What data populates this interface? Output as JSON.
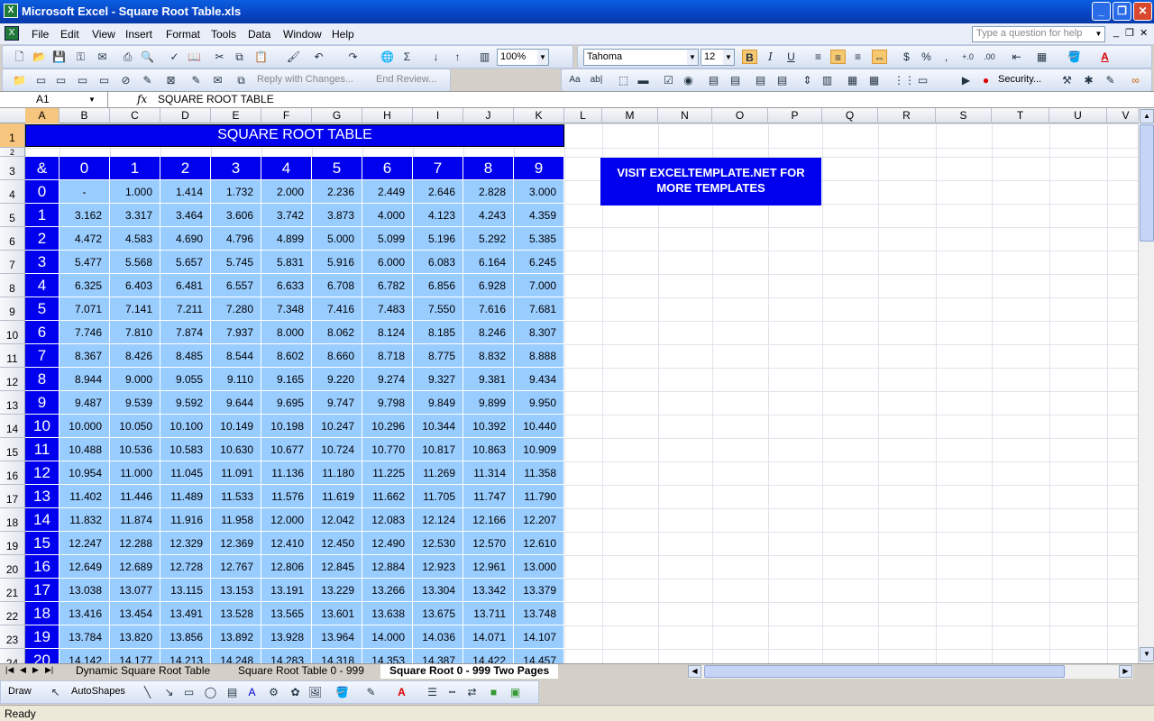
{
  "window": {
    "title": "Microsoft Excel - Square Root Table.xls",
    "app_icon": "excel-icon",
    "controls": [
      "_",
      "❐",
      "✕"
    ]
  },
  "menu": {
    "items": [
      "File",
      "Edit",
      "View",
      "Insert",
      "Format",
      "Tools",
      "Data",
      "Window",
      "Help"
    ],
    "help_placeholder": "Type a question for help",
    "doc_controls": [
      "_",
      "❐",
      "✕"
    ]
  },
  "toolbar": {
    "zoom": "100%",
    "font_name": "Tahoma",
    "font_size": "12",
    "bold": "B",
    "italic": "I",
    "underline": "U",
    "currency": "$",
    "percent": "%",
    "comma": ",",
    "sum": "Σ",
    "reply_changes": "Reply with Changes...",
    "end_review": "End Review...",
    "security": "Security..."
  },
  "formula_bar": {
    "name_box": "A1",
    "fx": "fx",
    "formula": "SQUARE ROOT TABLE"
  },
  "columns": [
    "A",
    "B",
    "C",
    "D",
    "E",
    "F",
    "G",
    "H",
    "I",
    "J",
    "K",
    "L",
    "M",
    "N",
    "O",
    "P",
    "Q",
    "R",
    "S",
    "T",
    "U",
    "V"
  ],
  "rows": [
    "1",
    "2",
    "3",
    "4",
    "5",
    "6",
    "7",
    "8",
    "9",
    "10",
    "11",
    "12",
    "13",
    "14",
    "15",
    "16",
    "17",
    "18",
    "19",
    "20",
    "21",
    "22",
    "23",
    "24"
  ],
  "sheet": {
    "title": "SQUARE ROOT TABLE",
    "corner": "&",
    "col_headers": [
      "0",
      "1",
      "2",
      "3",
      "4",
      "5",
      "6",
      "7",
      "8",
      "9"
    ],
    "row_headers": [
      "0",
      "1",
      "2",
      "3",
      "4",
      "5",
      "6",
      "7",
      "8",
      "9",
      "10",
      "11",
      "12",
      "13",
      "14",
      "15",
      "16",
      "17",
      "18",
      "19",
      "20"
    ],
    "values": [
      [
        "-",
        "1.000",
        "1.414",
        "1.732",
        "2.000",
        "2.236",
        "2.449",
        "2.646",
        "2.828",
        "3.000"
      ],
      [
        "3.162",
        "3.317",
        "3.464",
        "3.606",
        "3.742",
        "3.873",
        "4.000",
        "4.123",
        "4.243",
        "4.359"
      ],
      [
        "4.472",
        "4.583",
        "4.690",
        "4.796",
        "4.899",
        "5.000",
        "5.099",
        "5.196",
        "5.292",
        "5.385"
      ],
      [
        "5.477",
        "5.568",
        "5.657",
        "5.745",
        "5.831",
        "5.916",
        "6.000",
        "6.083",
        "6.164",
        "6.245"
      ],
      [
        "6.325",
        "6.403",
        "6.481",
        "6.557",
        "6.633",
        "6.708",
        "6.782",
        "6.856",
        "6.928",
        "7.000"
      ],
      [
        "7.071",
        "7.141",
        "7.211",
        "7.280",
        "7.348",
        "7.416",
        "7.483",
        "7.550",
        "7.616",
        "7.681"
      ],
      [
        "7.746",
        "7.810",
        "7.874",
        "7.937",
        "8.000",
        "8.062",
        "8.124",
        "8.185",
        "8.246",
        "8.307"
      ],
      [
        "8.367",
        "8.426",
        "8.485",
        "8.544",
        "8.602",
        "8.660",
        "8.718",
        "8.775",
        "8.832",
        "8.888"
      ],
      [
        "8.944",
        "9.000",
        "9.055",
        "9.110",
        "9.165",
        "9.220",
        "9.274",
        "9.327",
        "9.381",
        "9.434"
      ],
      [
        "9.487",
        "9.539",
        "9.592",
        "9.644",
        "9.695",
        "9.747",
        "9.798",
        "9.849",
        "9.899",
        "9.950"
      ],
      [
        "10.000",
        "10.050",
        "10.100",
        "10.149",
        "10.198",
        "10.247",
        "10.296",
        "10.344",
        "10.392",
        "10.440"
      ],
      [
        "10.488",
        "10.536",
        "10.583",
        "10.630",
        "10.677",
        "10.724",
        "10.770",
        "10.817",
        "10.863",
        "10.909"
      ],
      [
        "10.954",
        "11.000",
        "11.045",
        "11.091",
        "11.136",
        "11.180",
        "11.225",
        "11.269",
        "11.314",
        "11.358"
      ],
      [
        "11.402",
        "11.446",
        "11.489",
        "11.533",
        "11.576",
        "11.619",
        "11.662",
        "11.705",
        "11.747",
        "11.790"
      ],
      [
        "11.832",
        "11.874",
        "11.916",
        "11.958",
        "12.000",
        "12.042",
        "12.083",
        "12.124",
        "12.166",
        "12.207"
      ],
      [
        "12.247",
        "12.288",
        "12.329",
        "12.369",
        "12.410",
        "12.450",
        "12.490",
        "12.530",
        "12.570",
        "12.610"
      ],
      [
        "12.649",
        "12.689",
        "12.728",
        "12.767",
        "12.806",
        "12.845",
        "12.884",
        "12.923",
        "12.961",
        "13.000"
      ],
      [
        "13.038",
        "13.077",
        "13.115",
        "13.153",
        "13.191",
        "13.229",
        "13.266",
        "13.304",
        "13.342",
        "13.379"
      ],
      [
        "13.416",
        "13.454",
        "13.491",
        "13.528",
        "13.565",
        "13.601",
        "13.638",
        "13.675",
        "13.711",
        "13.748"
      ],
      [
        "13.784",
        "13.820",
        "13.856",
        "13.892",
        "13.928",
        "13.964",
        "14.000",
        "14.036",
        "14.071",
        "14.107"
      ],
      [
        "14.142",
        "14.177",
        "14.213",
        "14.248",
        "14.283",
        "14.318",
        "14.353",
        "14.387",
        "14.422",
        "14.457"
      ]
    ],
    "visit_text": "VISIT EXCELTEMPLATE.NET FOR MORE TEMPLATES"
  },
  "sheet_tabs": [
    "Dynamic Square Root Table",
    "Square Root Table 0 - 999",
    "Square Root 0 - 999 Two Pages"
  ],
  "active_tab": 2,
  "drawbar": {
    "draw": "Draw",
    "autoshapes": "AutoShapes"
  },
  "status": "Ready",
  "colors": {
    "header_blue": "#0000ee",
    "cell_blue": "#99ccff",
    "title_blue": "#0a5fe0"
  }
}
